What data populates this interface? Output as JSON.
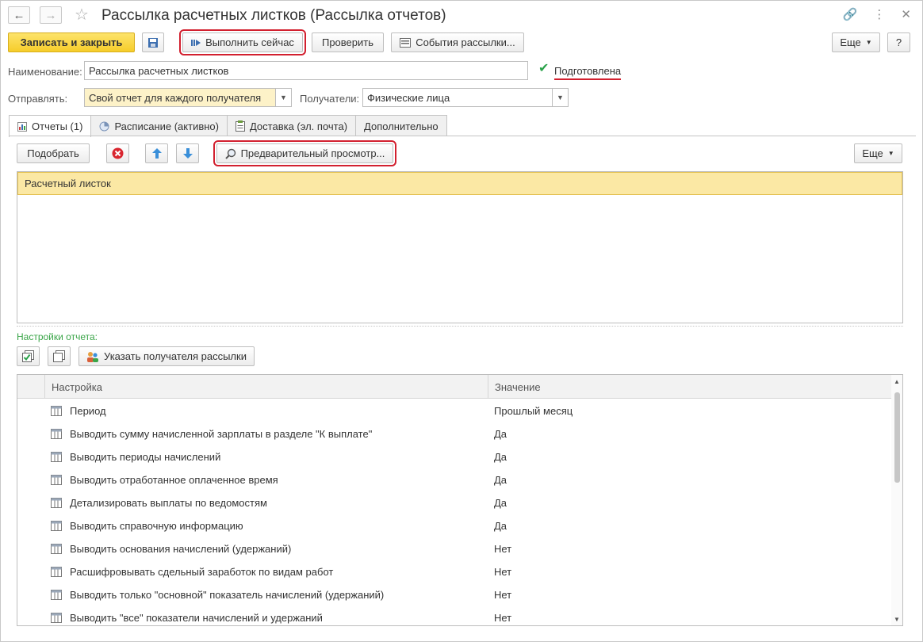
{
  "window": {
    "title": "Рассылка расчетных листков (Рассылка отчетов)"
  },
  "toolbar": {
    "save_close_label": "Записать и закрыть",
    "run_now_label": "Выполнить сейчас",
    "check_label": "Проверить",
    "events_label": "События рассылки...",
    "more_label": "Еще",
    "help_label": "?"
  },
  "form": {
    "name_label": "Наименование:",
    "name_value": "Рассылка расчетных листков",
    "prepared_label": "Подготовлена",
    "prepared_checked": true,
    "send_label": "Отправлять:",
    "send_value": "Свой отчет для каждого получателя",
    "recipients_label": "Получатели:",
    "recipients_value": "Физические лица"
  },
  "tabs": [
    {
      "label": "Отчеты (1)",
      "active": true,
      "icon": "report-icon"
    },
    {
      "label": "Расписание (активно)",
      "active": false,
      "icon": "clock-icon"
    },
    {
      "label": "Доставка (эл. почта)",
      "active": false,
      "icon": "clipboard-icon"
    },
    {
      "label": "Дополнительно",
      "active": false,
      "icon": ""
    }
  ],
  "reports_toolbar": {
    "pick_label": "Подобрать",
    "preview_label": "Предварительный просмотр...",
    "more_label": "Еще"
  },
  "reports": [
    "Расчетный листок"
  ],
  "settings": {
    "caption": "Настройки отчета:",
    "set_recipient_label": "Указать получателя рассылки",
    "columns": [
      "Настройка",
      "Значение"
    ],
    "rows": [
      {
        "name": "Период",
        "value": "Прошлый месяц"
      },
      {
        "name": "Выводить сумму начисленной зарплаты в разделе \"К выплате\"",
        "value": "Да"
      },
      {
        "name": "Выводить периоды начислений",
        "value": "Да"
      },
      {
        "name": "Выводить отработанное оплаченное время",
        "value": "Да"
      },
      {
        "name": "Детализировать выплаты по ведомостям",
        "value": "Да"
      },
      {
        "name": "Выводить справочную информацию",
        "value": "Да"
      },
      {
        "name": "Выводить основания начислений (удержаний)",
        "value": "Нет"
      },
      {
        "name": "Расшифровывать сдельный заработок по видам работ",
        "value": "Нет"
      },
      {
        "name": "Выводить только \"основной\" показатель начислений (удержаний)",
        "value": "Нет"
      },
      {
        "name": "Выводить \"все\" показатели начислений и удержаний",
        "value": "Нет"
      }
    ]
  },
  "colors": {
    "primary_button": "#f6cd2a",
    "selected_row": "#fbe8a4",
    "highlight_frame": "#d2202f",
    "caption_green": "#3aa548"
  }
}
